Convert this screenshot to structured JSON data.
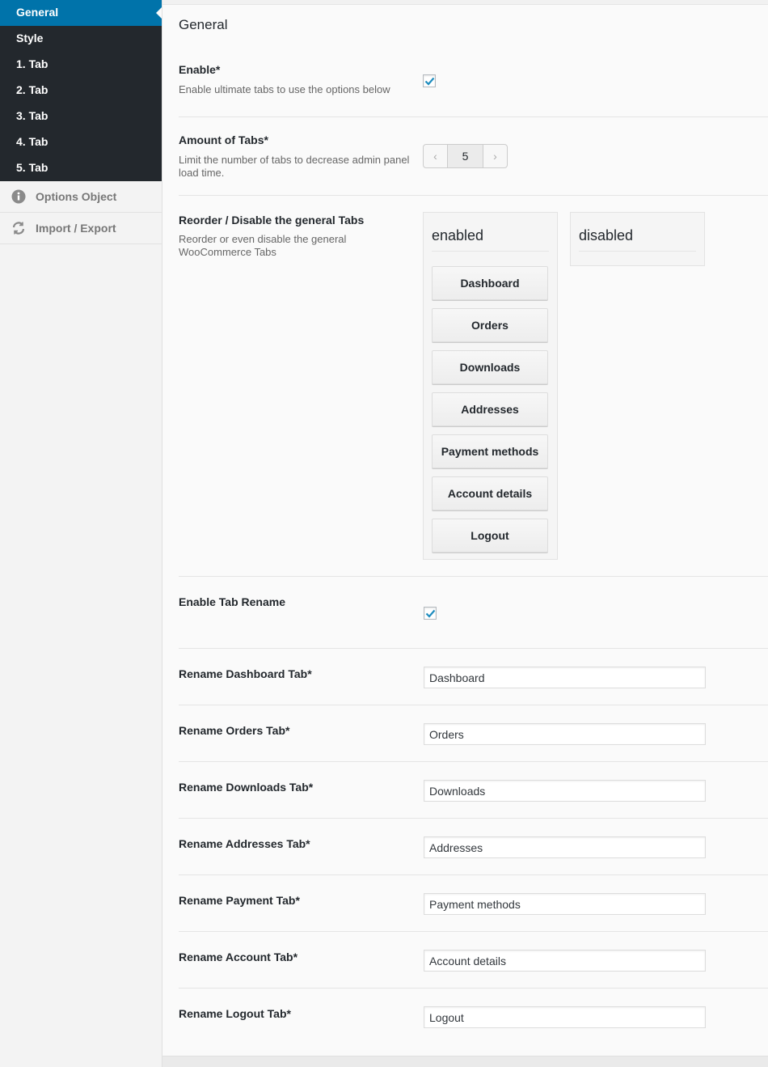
{
  "sidebar": {
    "dark_items": [
      {
        "label": "General",
        "active": true
      },
      {
        "label": "Style"
      },
      {
        "label": "1. Tab"
      },
      {
        "label": "2. Tab"
      },
      {
        "label": "3. Tab"
      },
      {
        "label": "4. Tab"
      },
      {
        "label": "5. Tab"
      }
    ],
    "light_items": [
      {
        "label": "Options Object",
        "icon": "info-icon"
      },
      {
        "label": "Import / Export",
        "icon": "refresh-icon"
      }
    ]
  },
  "main": {
    "title": "General",
    "enable": {
      "label": "Enable*",
      "description": "Enable ultimate tabs to use the options below",
      "checked": true
    },
    "amount": {
      "label": "Amount of Tabs*",
      "description": "Limit the number of tabs to decrease admin panel load time.",
      "value": "5",
      "prev": "‹",
      "next": "›"
    },
    "reorder": {
      "label": "Reorder / Disable the general Tabs",
      "description": "Reorder or even disable the general WooCommerce Tabs",
      "enabled_title": "enabled",
      "disabled_title": "disabled",
      "enabled_items": [
        "Dashboard",
        "Orders",
        "Downloads",
        "Addresses",
        "Payment methods",
        "Account details",
        "Logout"
      ],
      "disabled_items": []
    },
    "rename_enable": {
      "label": "Enable Tab Rename",
      "checked": true
    },
    "renames": [
      {
        "label": "Rename Dashboard Tab*",
        "value": "Dashboard"
      },
      {
        "label": "Rename Orders Tab*",
        "value": "Orders"
      },
      {
        "label": "Rename Downloads Tab*",
        "value": "Downloads"
      },
      {
        "label": "Rename Addresses Tab*",
        "value": "Addresses"
      },
      {
        "label": "Rename Payment Tab*",
        "value": "Payment methods"
      },
      {
        "label": "Rename Account Tab*",
        "value": "Account details"
      },
      {
        "label": "Rename Logout Tab*",
        "value": "Logout"
      }
    ]
  },
  "colors": {
    "accent": "#0073aa",
    "sidebar_dark": "#23282d"
  }
}
